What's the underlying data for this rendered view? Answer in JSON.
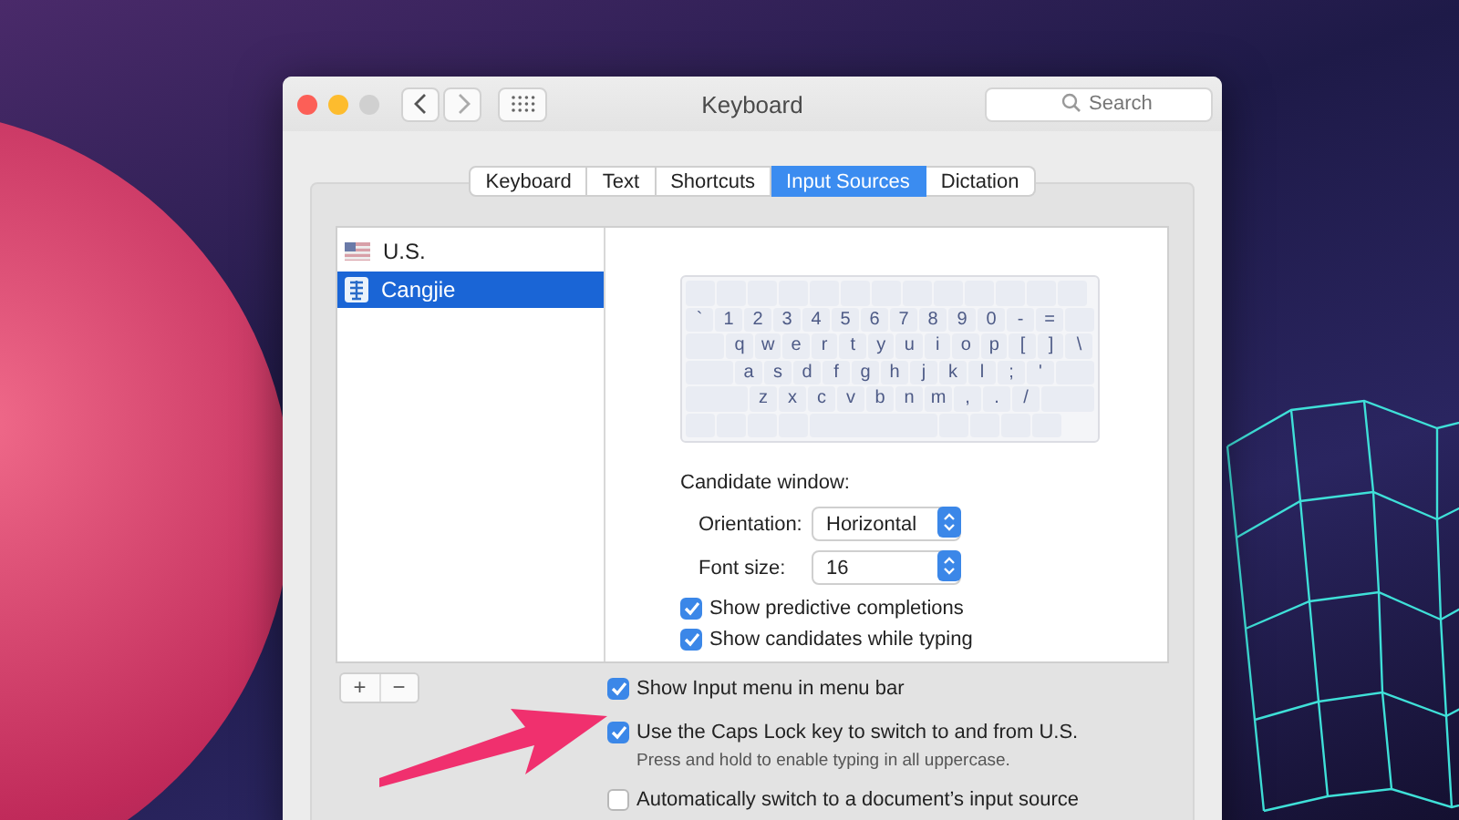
{
  "window": {
    "title": "Keyboard",
    "search": {
      "placeholder": "Search"
    }
  },
  "tabs": [
    {
      "label": "Keyboard",
      "selected": false
    },
    {
      "label": "Text",
      "selected": false
    },
    {
      "label": "Shortcuts",
      "selected": false
    },
    {
      "label": "Input Sources",
      "selected": true
    },
    {
      "label": "Dictation",
      "selected": false
    }
  ],
  "input_sources": [
    {
      "name": "U.S.",
      "kind": "flag",
      "selected": false
    },
    {
      "name": "Cangjie",
      "kind": "cangjie",
      "selected": true
    }
  ],
  "keyboard": {
    "rows": [
      {
        "keys": [
          "`",
          "1",
          "2",
          "3",
          "4",
          "5",
          "6",
          "7",
          "8",
          "9",
          "0",
          "-",
          "="
        ]
      },
      {
        "keys": [
          "q",
          "w",
          "e",
          "r",
          "t",
          "y",
          "u",
          "i",
          "o",
          "p",
          "[",
          "]",
          "\\"
        ]
      },
      {
        "keys": [
          "a",
          "s",
          "d",
          "f",
          "g",
          "h",
          "j",
          "k",
          "l",
          ";",
          "'"
        ]
      },
      {
        "keys": [
          "z",
          "x",
          "c",
          "v",
          "b",
          "n",
          "m",
          ",",
          ".",
          "/"
        ]
      }
    ]
  },
  "candidate_window": {
    "heading": "Candidate window:",
    "fields": [
      {
        "label": "Orientation:",
        "value": "Horizontal"
      },
      {
        "label": "Font size:",
        "value": "16"
      }
    ],
    "options": [
      {
        "label": "Show predictive completions",
        "checked": true
      },
      {
        "label": "Show candidates while typing",
        "checked": true
      }
    ]
  },
  "list_buttons": [
    "+",
    "−"
  ],
  "options": [
    {
      "label": "Show Input menu in menu bar",
      "checked": true
    },
    {
      "label": "Use the Caps Lock key to switch to and from U.S.",
      "checked": true,
      "note": "Press and hold to enable typing in all uppercase."
    },
    {
      "label": "Automatically switch to a document’s input source",
      "checked": false
    }
  ]
}
